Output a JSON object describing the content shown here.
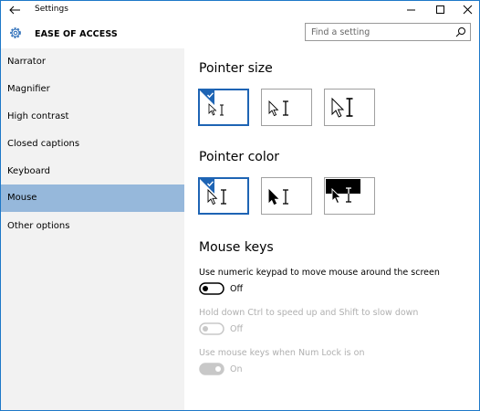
{
  "window": {
    "title": "Settings"
  },
  "header": {
    "title": "EASE OF ACCESS",
    "search_placeholder": "Find a setting"
  },
  "sidebar": {
    "items": [
      {
        "label": "Narrator"
      },
      {
        "label": "Magnifier"
      },
      {
        "label": "High contrast"
      },
      {
        "label": "Closed captions"
      },
      {
        "label": "Keyboard"
      },
      {
        "label": "Mouse",
        "selected": true
      },
      {
        "label": "Other options"
      }
    ]
  },
  "main": {
    "pointer_size": {
      "title": "Pointer size",
      "options": [
        "small",
        "medium",
        "large"
      ],
      "selected": "small"
    },
    "pointer_color": {
      "title": "Pointer color",
      "options": [
        "white",
        "black",
        "inverted"
      ],
      "selected": "white"
    },
    "mouse_keys": {
      "title": "Mouse keys",
      "numeric_keypad": {
        "label": "Use numeric keypad to move mouse around the screen",
        "state": "Off",
        "enabled": true
      },
      "ctrl_shift": {
        "label": "Hold down Ctrl to speed up and Shift to slow down",
        "state": "Off",
        "enabled": false
      },
      "num_lock": {
        "label": "Use mouse keys when Num Lock is on",
        "state": "On",
        "enabled": false
      }
    }
  },
  "colors": {
    "accent": "#1e64b4",
    "sidebar_bg": "#f2f2f2",
    "selected_nav": "#96b8db",
    "disabled_text": "#b0b0b0"
  },
  "icons": [
    "back-arrow-icon",
    "gear-icon",
    "search-icon",
    "minimize-icon",
    "maximize-icon",
    "close-icon",
    "checkmark-icon"
  ]
}
